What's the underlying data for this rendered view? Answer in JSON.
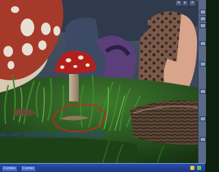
{
  "viewport": {
    "caption": "ah vom Grashalm geht durchs Blatt"
  },
  "right_panel": {
    "icons": [
      "panel-icon",
      "panel-icon",
      "panel-icon",
      "panel-icon",
      "panel-icon",
      "panel-icon",
      "panel-icon",
      "panel-icon"
    ]
  },
  "top_tabs": [
    {
      "label": "≡"
    },
    {
      "label": "▸"
    },
    {
      "label": "✕"
    }
  ],
  "taskbar": {
    "items": [
      {
        "label": "Conten"
      },
      {
        "label": "Conter"
      }
    ]
  },
  "colors": {
    "caption": "#2f3bd8",
    "highlight_circle": "#d21f1f",
    "taskbar": "#1a3884"
  }
}
